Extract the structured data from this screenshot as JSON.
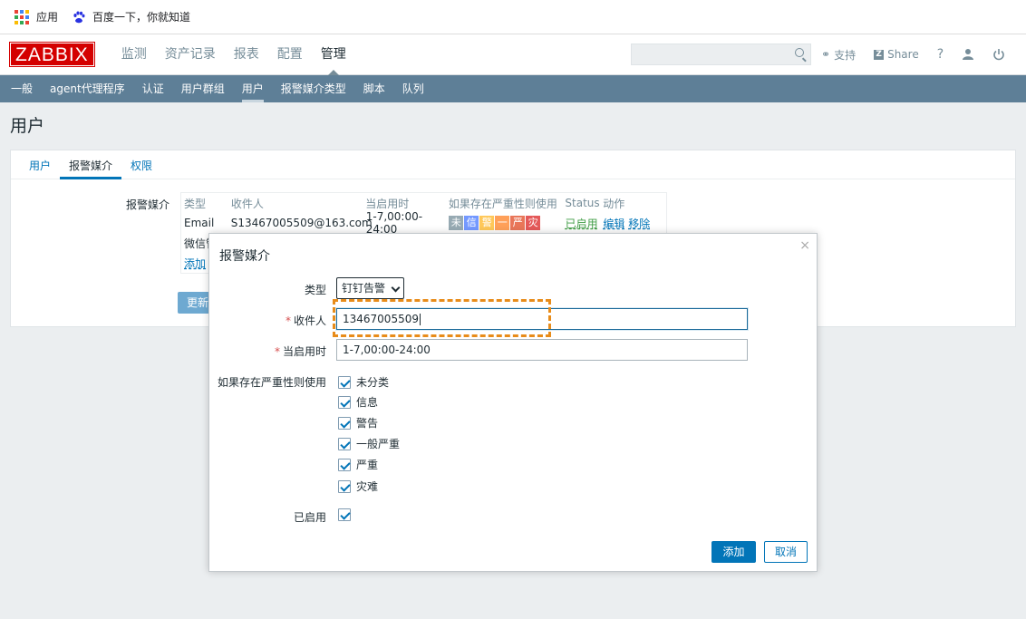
{
  "bookmarks": {
    "apps_label": "应用",
    "baidu_label": "百度一下，你就知道"
  },
  "header": {
    "logo": "ZABBIX",
    "nav": [
      "监测",
      "资产记录",
      "报表",
      "配置",
      "管理"
    ],
    "active_nav": "管理",
    "search_placeholder": "",
    "support_label": "支持",
    "share_label": "Share",
    "help_label": "?"
  },
  "subnav": [
    "一般",
    "agent代理程序",
    "认证",
    "用户群组",
    "用户",
    "报警媒介类型",
    "脚本",
    "队列"
  ],
  "page_title": "用户",
  "tabs": [
    "用户",
    "报警媒介",
    "权限"
  ],
  "media": {
    "label": "报警媒介",
    "headers": [
      "类型",
      "收件人",
      "当启用时",
      "如果存在严重性则使用",
      "Status",
      "动作"
    ],
    "row": {
      "type": "Email",
      "recipient": "S13467005509@163.com",
      "when_active": "1-7,00:00-24:00",
      "severities": [
        "未",
        "信",
        "警",
        "一",
        "严",
        "灾"
      ],
      "severity_colors": [
        "#97AAB3",
        "#7499FF",
        "#FFC859",
        "#FFA059",
        "#E97659",
        "#E45959"
      ],
      "status": "已启用",
      "edit": "编辑",
      "remove": "移除"
    },
    "row2_type": "微信管",
    "add_link": "添加",
    "update_button": "更新"
  },
  "modal": {
    "title": "报警媒介",
    "close": "×",
    "type_label": "类型",
    "type_value": "钉钉告警",
    "recipient_label": "收件人",
    "recipient_value": "13467005509",
    "when_active_label": "当启用时",
    "when_active_value": "1-7,00:00-24:00",
    "severity_label": "如果存在严重性则使用",
    "severities": [
      "未分类",
      "信息",
      "警告",
      "一般严重",
      "严重",
      "灾难"
    ],
    "enabled_label": "已启用",
    "add_button": "添加",
    "cancel_button": "取消"
  }
}
